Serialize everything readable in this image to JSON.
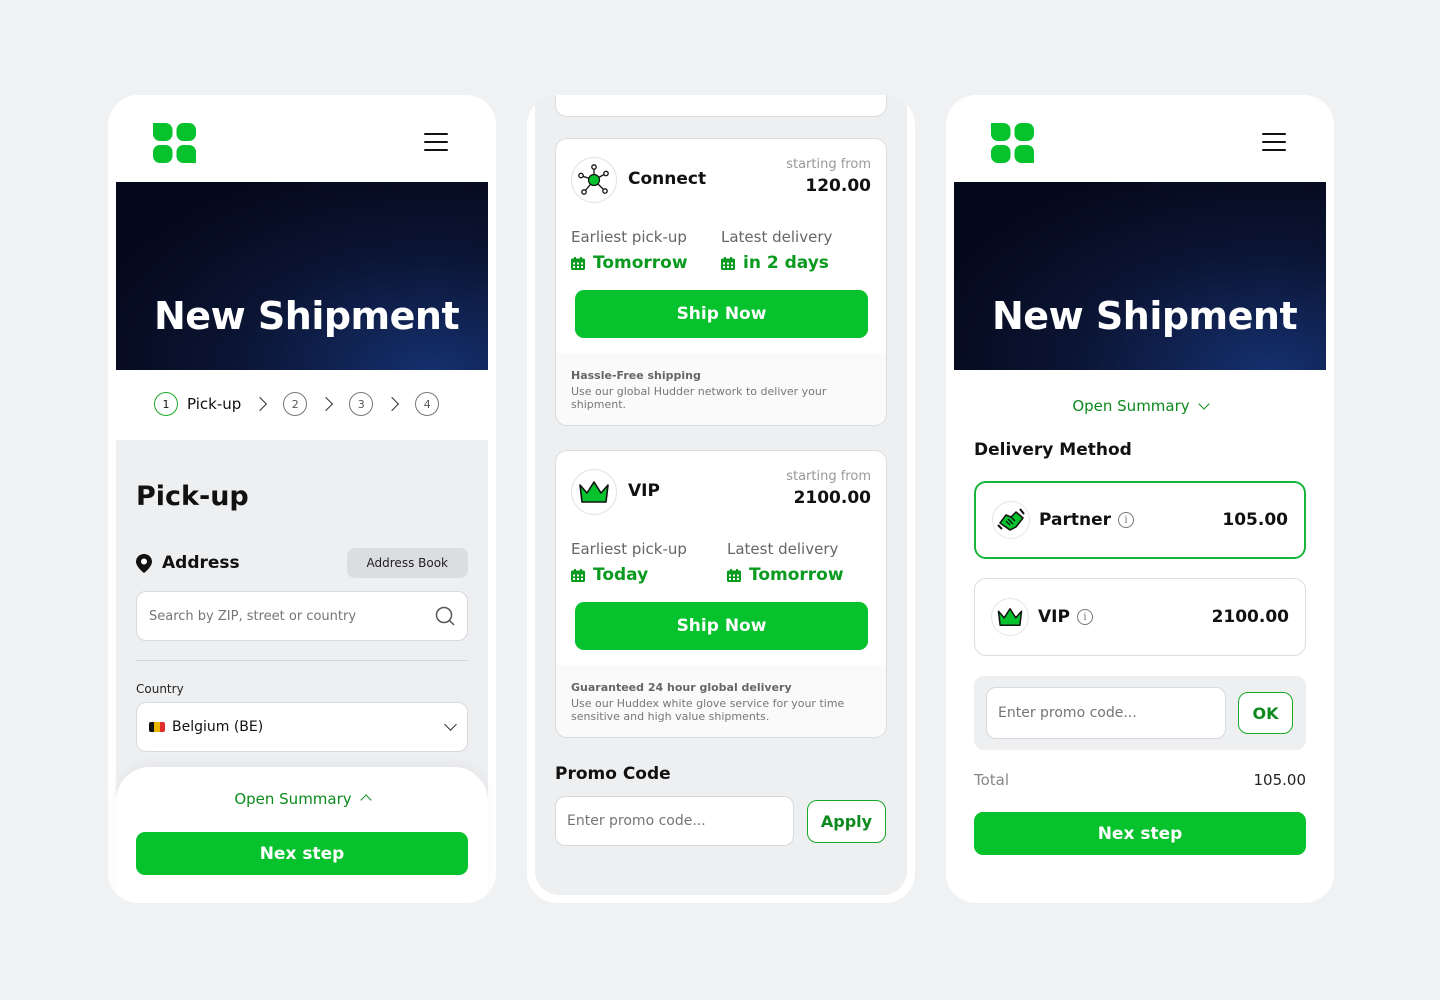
{
  "colors": {
    "accent": "#06c22c",
    "accent_dark": "#0d8a1e",
    "hero": "#0b1433"
  },
  "screen1": {
    "hero_title": "New Shipment",
    "steps": [
      {
        "num": "1",
        "label": "Pick-up"
      },
      {
        "num": "2"
      },
      {
        "num": "3"
      },
      {
        "num": "4"
      }
    ],
    "section_title": "Pick-up",
    "address_label": "Address",
    "address_book_btn": "Address Book",
    "search_placeholder": "Search by ZIP, street or country",
    "country_label": "Country",
    "country_value": "Belgium (BE)",
    "open_summary": "Open Summary",
    "next_btn": "Nex step"
  },
  "screen2": {
    "cards": [
      {
        "name": "Connect",
        "starting_from": "starting from",
        "price": "120.00",
        "pickup_label": "Earliest pick-up",
        "pickup_value": "Tomorrow",
        "delivery_label": "Latest delivery",
        "delivery_value": "in 2 days",
        "ship_btn": "Ship Now",
        "footer_title": "Hassle-Free shipping",
        "footer_text": "Use our global Hudder network to deliver your shipment."
      },
      {
        "name": "VIP",
        "starting_from": "starting from",
        "price": "2100.00",
        "pickup_label": "Earliest pick-up",
        "pickup_value": "Today",
        "delivery_label": "Latest delivery",
        "delivery_value": "Tomorrow",
        "ship_btn": "Ship Now",
        "footer_title": "Guaranteed 24 hour global delivery",
        "footer_text": "Use our Huddex white glove service for your time sensitive and high value shipments."
      }
    ],
    "promo_title": "Promo Code",
    "promo_placeholder": "Enter promo code...",
    "apply_btn": "Apply"
  },
  "screen3": {
    "hero_title": "New Shipment",
    "open_summary": "Open Summary",
    "delivery_method_title": "Delivery Method",
    "options": [
      {
        "name": "Partner",
        "price": "105.00",
        "icon": "handshake-icon",
        "selected": true
      },
      {
        "name": "VIP",
        "price": "2100.00",
        "icon": "crown-icon",
        "selected": false
      }
    ],
    "promo_placeholder": "Enter promo code...",
    "ok_btn": "OK",
    "total_label": "Total",
    "total_value": "105.00",
    "next_btn": "Nex step"
  }
}
